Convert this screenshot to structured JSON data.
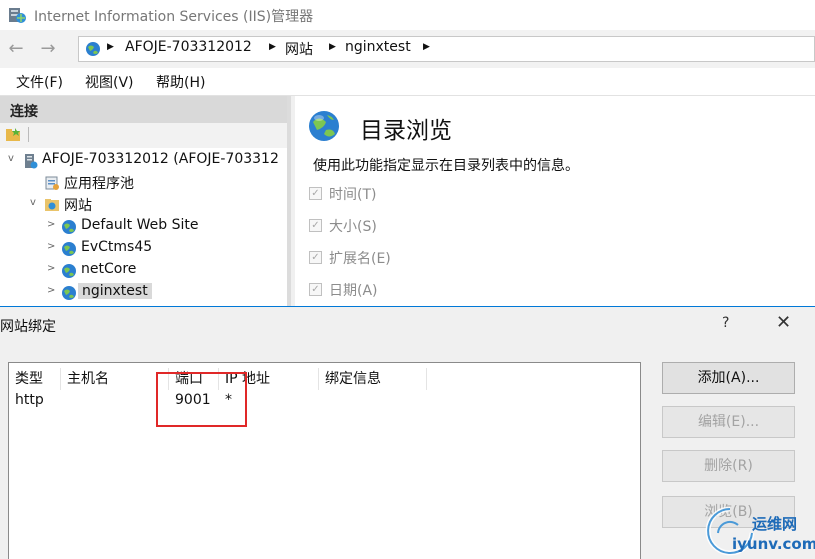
{
  "window": {
    "title": "Internet Information Services (IIS)管理器"
  },
  "address": {
    "back_icon": "back-arrow-icon",
    "forward_icon": "forward-arrow-icon",
    "crumbs": [
      "AFOJE-703312012",
      "网站",
      "nginxtest"
    ]
  },
  "menu": {
    "items": [
      "文件(F)",
      "视图(V)",
      "帮助(H)"
    ]
  },
  "connections": {
    "header": "连接",
    "tree": [
      {
        "label": "AFOJE-703312012 (AFOJE-703312",
        "icon": "server-icon",
        "expander": "v"
      },
      {
        "label": "应用程序池",
        "icon": "app-pool-icon",
        "expander": ""
      },
      {
        "label": "网站",
        "icon": "sites-folder-icon",
        "expander": "v"
      },
      {
        "label": "Default Web Site",
        "icon": "globe-icon",
        "expander": ">"
      },
      {
        "label": "EvCtms45",
        "icon": "globe-icon",
        "expander": ">"
      },
      {
        "label": "netCore",
        "icon": "globe-icon",
        "expander": ">"
      },
      {
        "label": "nginxtest",
        "icon": "globe-icon",
        "expander": ">"
      }
    ]
  },
  "feature": {
    "title": "目录浏览",
    "description": "使用此功能指定显示在目录列表中的信息。",
    "options": [
      {
        "label": "时间(T)",
        "checked": true
      },
      {
        "label": "大小(S)",
        "checked": true
      },
      {
        "label": "扩展名(E)",
        "checked": true
      },
      {
        "label": "日期(A)",
        "checked": true
      }
    ]
  },
  "dialog": {
    "title": "网站绑定",
    "help": "?",
    "close": "✕",
    "columns": [
      "类型",
      "主机名",
      "端口",
      "IP 地址",
      "绑定信息"
    ],
    "rows": [
      {
        "type": "http",
        "host": "",
        "port": "9001",
        "ip": "*",
        "info": ""
      }
    ],
    "buttons": [
      {
        "label": "添加(A)...",
        "enabled": true
      },
      {
        "label": "编辑(E)...",
        "enabled": false
      },
      {
        "label": "删除(R)",
        "enabled": false
      },
      {
        "label": "浏览(B)",
        "enabled": false
      }
    ]
  },
  "watermark": {
    "brand": "运维网",
    "domain": "iyunv.com"
  },
  "colors": {
    "highlight": "#e02828",
    "dialog_border": "#0078d7",
    "watermark": "#1e6bb8"
  }
}
